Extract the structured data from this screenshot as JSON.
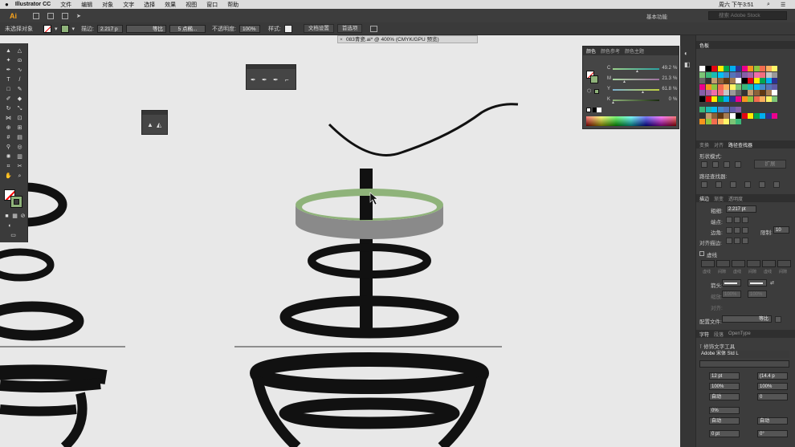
{
  "menubar": {
    "app_name": "Illustrator CC",
    "items": [
      "文件",
      "编辑",
      "对象",
      "文字",
      "选择",
      "效果",
      "视图",
      "窗口",
      "帮助"
    ],
    "clock": "周六 下午3:51"
  },
  "appbar": {
    "logo": "Ai",
    "workspace": "基本功能",
    "search_placeholder": "搜索 Adobe Stock"
  },
  "control": {
    "selection_label": "未选择对象",
    "stroke_label": "描边:",
    "stroke_value": "2.217 p",
    "profile_value": "等比",
    "brush_value": "5 点椭...",
    "opacity_label": "不透明度:",
    "opacity_value": "100%",
    "style_label": "样式:",
    "doc_setup": "文档设置",
    "prefs": "首选项"
  },
  "document": {
    "tab_title": "083青瓷.ai* @ 400% (CMYK/GPU 预览)"
  },
  "color_panel": {
    "tabs": [
      "颜色",
      "颜色参考",
      "颜色主题"
    ],
    "channels": [
      {
        "label": "C",
        "value": "49.2",
        "color": "#00aeef"
      },
      {
        "label": "M",
        "value": "21.3",
        "color": "#ec008c"
      },
      {
        "label": "Y",
        "value": "61.8",
        "color": "#fff200"
      },
      {
        "label": "K",
        "value": "0",
        "color": "#000000"
      }
    ],
    "percent": "%",
    "fill_color": "#8fb37a"
  },
  "swatches_panel": {
    "title": "色板"
  },
  "pathfinder": {
    "tabs": [
      "变换",
      "对齐",
      "路径查找器"
    ],
    "shape_modes": "形状模式:",
    "expand": "扩展",
    "pathfinders": "路径查找器:"
  },
  "stroke_panel": {
    "tabs": [
      "描边",
      "渐变",
      "透明度"
    ],
    "weight_label": "粗细:",
    "weight_value": "2.217 pt",
    "cap_label": "端点:",
    "corner_label": "边角:",
    "limit_label": "限制:",
    "limit_value": "10",
    "align_label": "对齐描边:",
    "dashed_label": "虚线",
    "dash_cells": [
      "虚线",
      "间隙",
      "虚线",
      "间隙",
      "虚线",
      "间隙"
    ],
    "arrow_label": "箭头:",
    "scale_label": "缩放:",
    "scale1": "100%",
    "scale2": "100%",
    "align2_label": "对齐:",
    "profile_label": "配置文件:",
    "profile_value": "等比"
  },
  "char_panel": {
    "tabs": [
      "字符",
      "段落",
      "OpenType"
    ],
    "touch_type": "修饰文字工具",
    "font_name": "Adobe 宋体 Std L",
    "font_size": "12 pt",
    "leading": "(14.4 p",
    "h_scale": "100%",
    "v_scale": "100%",
    "kerning": "自动",
    "tracking": "0",
    "baseline": "0%",
    "auto1": "自动",
    "auto2": "自动",
    "shift": "0 pt",
    "rotate": "0°"
  },
  "colors": {
    "ui_dark": "#3b3b3b",
    "canvas": "#e8e8e8",
    "ellipse_green": "#8fb37a",
    "ellipse_gray": "#8a8a8a"
  }
}
